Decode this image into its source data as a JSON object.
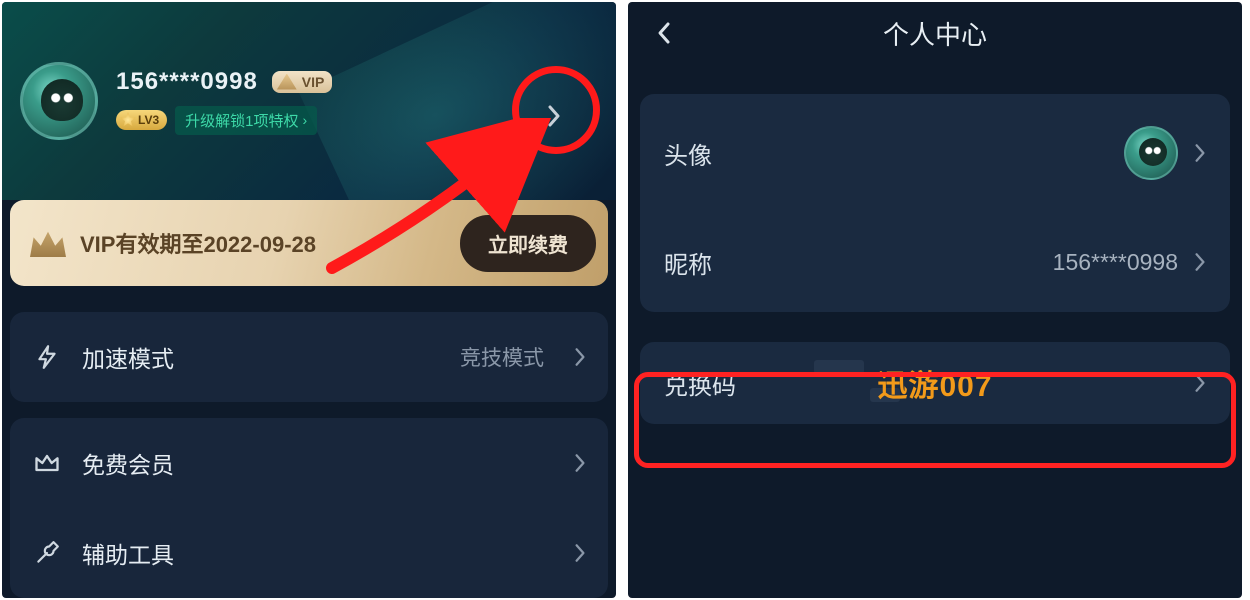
{
  "left": {
    "username": "156****0998",
    "vip_badge_text": "VIP",
    "level_badge": "LV3",
    "upgrade_text": "升级解锁1项特权",
    "vip_expire_text": "VIP有效期至2022-09-28",
    "renew_button": "立即续费",
    "rows": {
      "accel_mode": {
        "label": "加速模式",
        "value": "竞技模式"
      },
      "free_member": {
        "label": "免费会员"
      },
      "assist_tools": {
        "label": "辅助工具"
      }
    }
  },
  "right": {
    "title": "个人中心",
    "rows": {
      "avatar": {
        "label": "头像"
      },
      "nickname": {
        "label": "昵称",
        "value": "156****0998"
      },
      "redeem_code": {
        "label": "兑换码",
        "value": "迅游007"
      }
    }
  }
}
